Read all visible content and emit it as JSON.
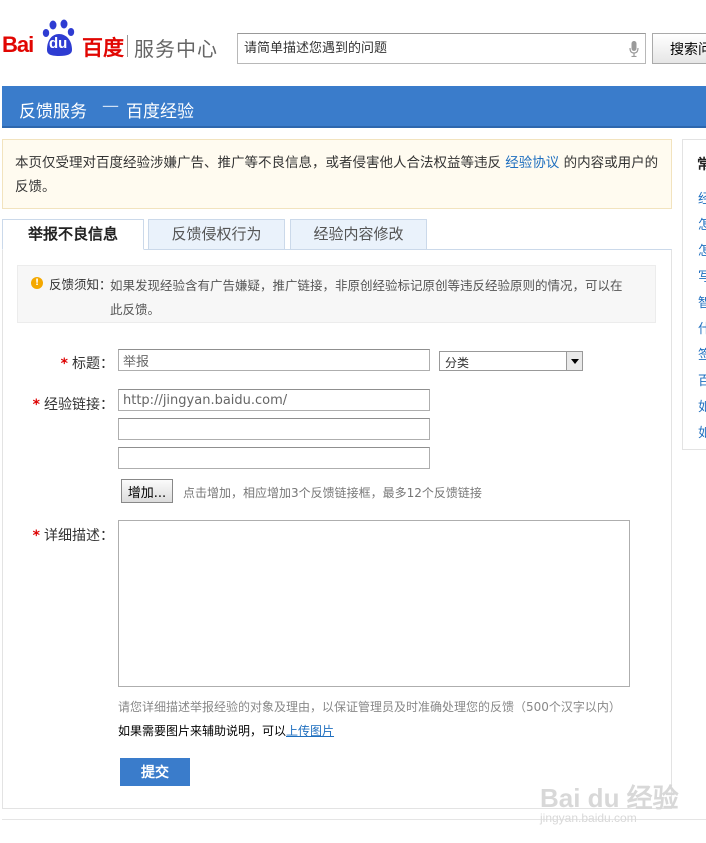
{
  "header": {
    "logo_bai": "Bai",
    "logo_du": "du",
    "logo_cn": "百度",
    "service_name": "服务中心",
    "search_placeholder": "请简单描述您遇到的问题",
    "search_button": "搜索问"
  },
  "titlebar": {
    "section": "反馈服务",
    "separator": "—",
    "product": "百度经验"
  },
  "notice": {
    "text_before": "本页仅受理对百度经验涉嫌广告、推广等不良信息，或者侵害他人合法权益等违反",
    "link": "经验协议",
    "text_after": "的内容或用户的反馈。"
  },
  "sidebar": {
    "heading": "常",
    "items": [
      "经",
      "怎",
      "怎",
      "写",
      "智",
      "什",
      "签",
      "百",
      "如",
      "如"
    ]
  },
  "tabs": [
    {
      "label": "举报不良信息",
      "active": true
    },
    {
      "label": "反馈侵权行为",
      "active": false
    },
    {
      "label": "经验内容修改",
      "active": false
    }
  ],
  "tips": {
    "label": "反馈须知：",
    "text": "如果发现经验含有广告嫌疑，推广链接，非原创经验标记原创等违反经验原则的情况，可以在此反馈。"
  },
  "form": {
    "required_mark": "*",
    "title_label": "标题：",
    "title_value": "举报",
    "category_value": "分类",
    "link_label": "经验链接：",
    "link_value_1": "http://jingyan.baidu.com/",
    "add_button": "增加...",
    "add_tip": "点击增加，相应增加3个反馈链接框，最多12个反馈链接",
    "detail_label": "详细描述：",
    "detail_hint": "请您详细描述举报经验的对象及理由，以保证管理员及时准确处理您的反馈（500个汉字以内）",
    "image_text": "如果需要图片来辅助说明，可以",
    "image_link": "上传图片",
    "submit_button": "提交"
  },
  "watermark": {
    "brand": "Bai du 经验",
    "url": "jingyan.baidu.com"
  },
  "colors": {
    "brand_red": "#e10602",
    "brand_blue": "#3a7ccb",
    "link_blue": "#1f6fbf",
    "required_red": "#dd0000"
  }
}
